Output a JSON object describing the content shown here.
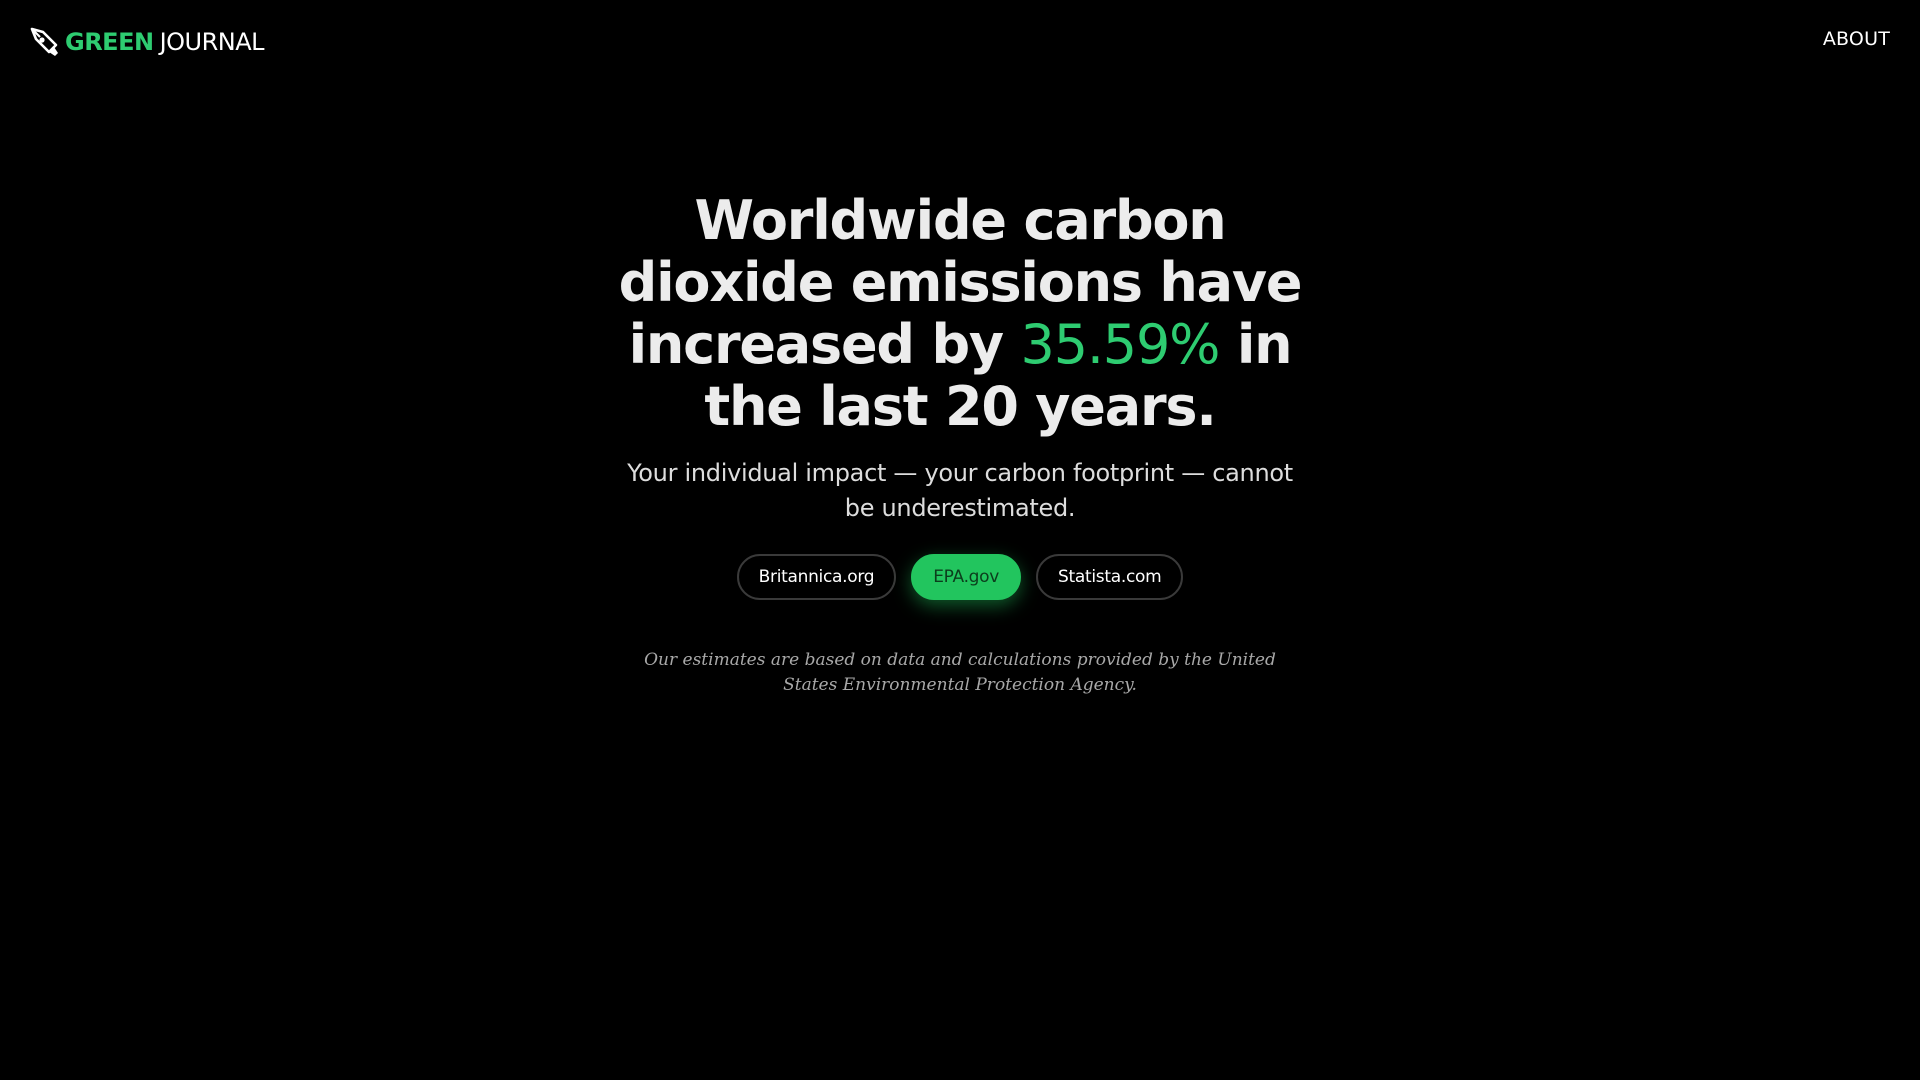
{
  "brand": {
    "green_text": "GREEN",
    "journal_text": "JOURNAL",
    "icon": "pen-nib-icon",
    "accent_color": "#2ecc71"
  },
  "nav": {
    "about_label": "ABOUT"
  },
  "hero": {
    "headline_part1": "Worldwide carbon dioxide emissions have increased by ",
    "headline_stat": "35.59%",
    "headline_part2": " in the last 20 years.",
    "subheadline": "Your individual impact — your carbon footprint — cannot be underestimated."
  },
  "sources": {
    "items": [
      {
        "label": "Britannica.org",
        "active": false
      },
      {
        "label": "EPA.gov",
        "active": true
      },
      {
        "label": "Statista.com",
        "active": false
      }
    ],
    "active_color": "#22c55e"
  },
  "disclaimer": "Our estimates are based on data and calculations provided by the United States Environmental Protection Agency."
}
